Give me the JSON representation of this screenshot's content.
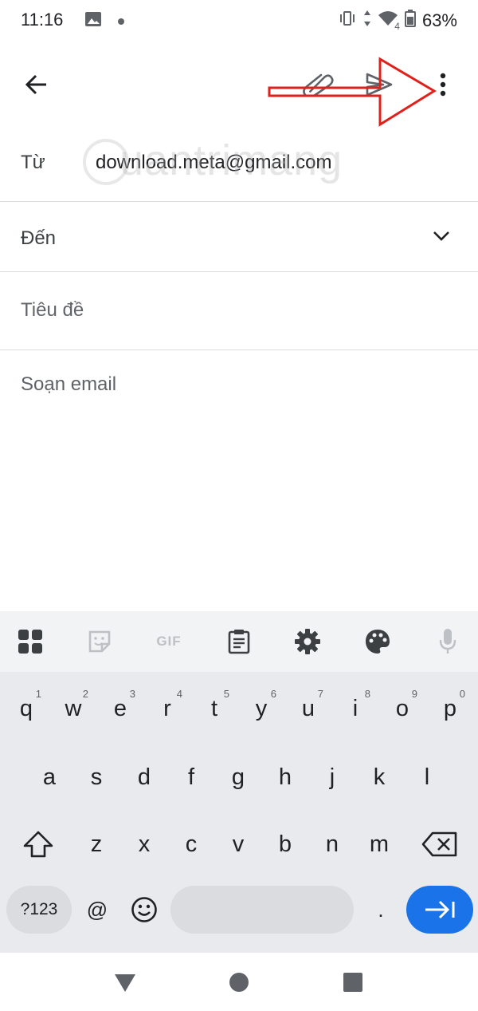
{
  "status_bar": {
    "time": "11:16",
    "battery": "63%",
    "network_badge": "4"
  },
  "compose": {
    "from_label": "Từ",
    "from_value": "download.meta@gmail.com",
    "to_label": "Đến",
    "subject_placeholder": "Tiêu đề",
    "body_placeholder": "Soạn email",
    "watermark_text": "uantrimang"
  },
  "keyboard": {
    "toolbar": {
      "gif_label": "GIF"
    },
    "row1": [
      {
        "key": "q",
        "num": "1"
      },
      {
        "key": "w",
        "num": "2"
      },
      {
        "key": "e",
        "num": "3"
      },
      {
        "key": "r",
        "num": "4"
      },
      {
        "key": "t",
        "num": "5"
      },
      {
        "key": "y",
        "num": "6"
      },
      {
        "key": "u",
        "num": "7"
      },
      {
        "key": "i",
        "num": "8"
      },
      {
        "key": "o",
        "num": "9"
      },
      {
        "key": "p",
        "num": "0"
      }
    ],
    "row2": [
      "a",
      "s",
      "d",
      "f",
      "g",
      "h",
      "j",
      "k",
      "l"
    ],
    "row3": [
      "z",
      "x",
      "c",
      "v",
      "b",
      "n",
      "m"
    ],
    "symbols_label": "?123",
    "at_label": "@",
    "period_label": "."
  },
  "colors": {
    "accent": "#1a73e8",
    "annotation": "#e0201b",
    "keyboard_bg": "#e8eaed"
  }
}
